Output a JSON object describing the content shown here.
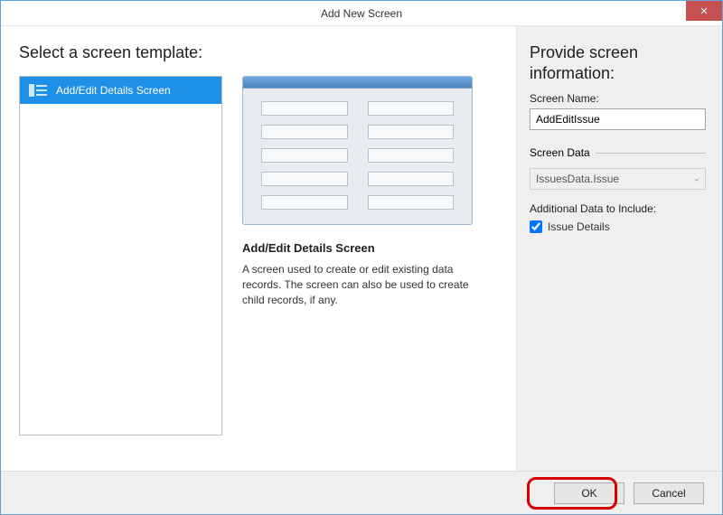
{
  "window": {
    "title": "Add New Screen",
    "close_icon": "✕"
  },
  "left": {
    "heading": "Select a screen template:",
    "templates": [
      {
        "label": "Add/Edit Details Screen"
      }
    ],
    "preview": {
      "name": "Add/Edit Details Screen",
      "description": "A screen used to create or edit existing data records. The screen can also be used to create child records, if any."
    }
  },
  "right": {
    "heading": "Provide screen information:",
    "screen_name_label": "Screen Name:",
    "screen_name_value": "AddEditIssue",
    "screen_data_group": "Screen Data",
    "screen_data_value": "IssuesData.Issue",
    "additional_label": "Additional Data to Include:",
    "additional_items": [
      {
        "label": "Issue Details",
        "checked": true
      }
    ]
  },
  "footer": {
    "ok": "OK",
    "cancel": "Cancel"
  }
}
